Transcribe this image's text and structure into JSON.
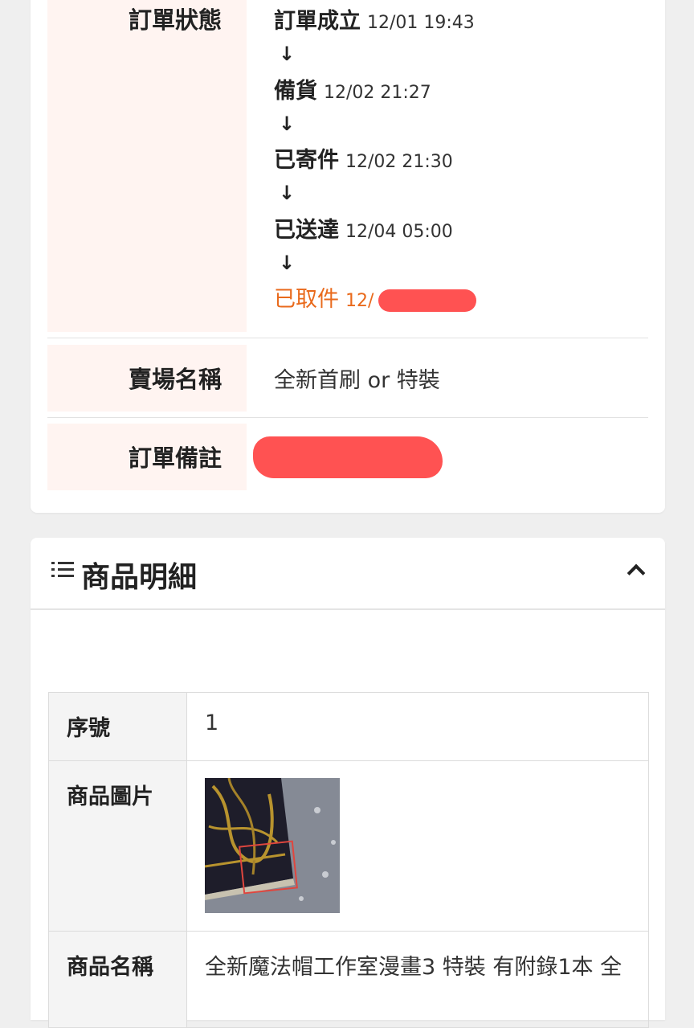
{
  "order_info": {
    "status_label": "訂單狀態",
    "steps": [
      {
        "name": "訂單成立",
        "time": "12/01 19:43"
      },
      {
        "name": "備貨",
        "time": "12/02 21:27"
      },
      {
        "name": "已寄件",
        "time": "12/02 21:30"
      },
      {
        "name": "已送達",
        "time": "12/04 05:00"
      },
      {
        "name": "已取件",
        "time": "12/"
      }
    ],
    "arrow": "↓",
    "shop_label": "賣場名稱",
    "shop_value": "全新首刷 or 特裝",
    "note_label": "訂單備註"
  },
  "products": {
    "title": "商品明細",
    "icon": "list-icon",
    "toggle_icon": "chevron-up-icon",
    "rows": {
      "index_label": "序號",
      "index_value": "1",
      "image_label": "商品圖片",
      "name_label": "商品名稱",
      "name_value": "全新魔法帽工作室漫畫3 特裝 有附錄1本 全"
    }
  },
  "colors": {
    "accent": "#e96a1c",
    "label_bg": "#fff4f1",
    "redaction": "#ff5252"
  }
}
